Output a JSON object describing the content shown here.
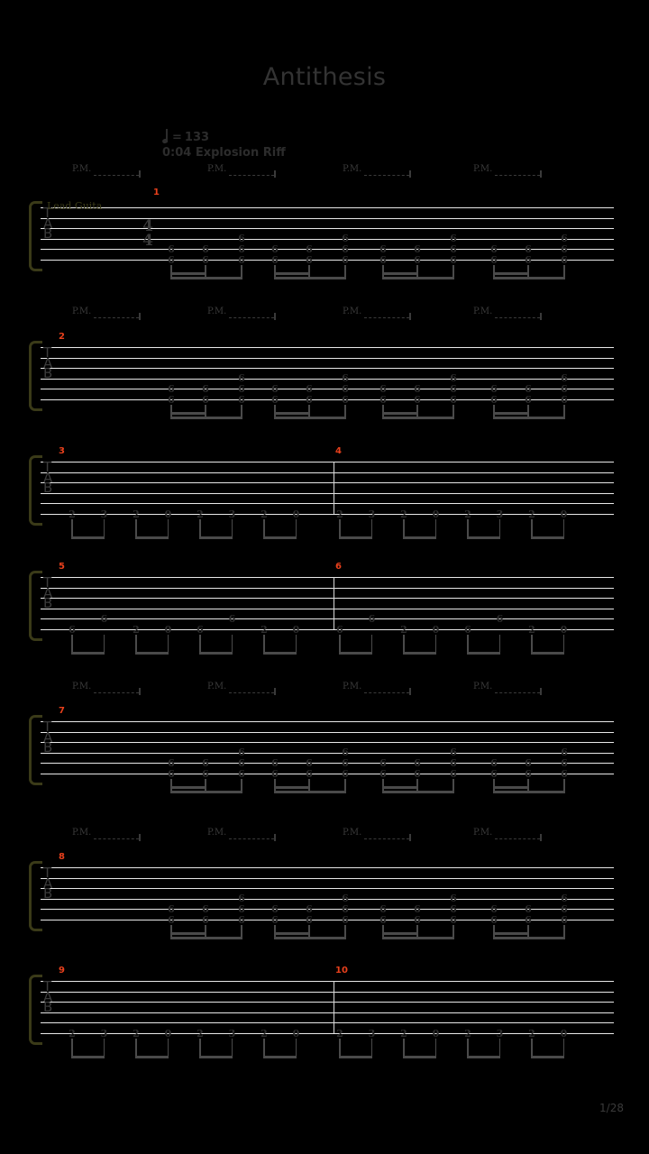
{
  "document": {
    "title": "Antithesis",
    "page_label": "1/28",
    "background_color": "#000000",
    "accent_color": "#e8401c",
    "staff_line_color": "#e8e8e8",
    "note_color": "#2e2e2e",
    "bracket_color": "#3a3a18"
  },
  "tempo": {
    "note_icon": "quarter-note-icon",
    "equals": "=",
    "bpm": "133"
  },
  "section": {
    "label": "0:04 Explosion Riff"
  },
  "instrument": {
    "name": "Lead Guita",
    "clef": "TAB",
    "time_signature": {
      "numerator": "4",
      "denominator": "4"
    }
  },
  "palm_mute": {
    "label": "P.M."
  },
  "systems": [
    {
      "id": "system-1",
      "measure_numbers": [
        "1"
      ],
      "pm_count": 4,
      "pattern": "power-chord-riff",
      "measures": [
        {
          "notes": [
            {
              "string": 6,
              "fret": "6"
            },
            {
              "string": 5,
              "fret": "6"
            },
            {
              "string": 6,
              "fret": "6"
            },
            {
              "string": 5,
              "fret": "6"
            },
            {
              "string": 6,
              "fret": "6"
            },
            {
              "string": 5,
              "fret": "6"
            },
            {
              "string": 4,
              "fret": "6"
            }
          ]
        }
      ]
    },
    {
      "id": "system-2",
      "measure_numbers": [
        "2"
      ],
      "pm_count": 4,
      "pattern": "power-chord-riff"
    },
    {
      "id": "system-3",
      "measure_numbers": [
        "3",
        "4"
      ],
      "pm_count": 0,
      "pattern": "single-note-run",
      "frets": [
        "2",
        "3",
        "2",
        "0",
        "2",
        "3",
        "2",
        "0",
        "2",
        "3",
        "2",
        "0",
        "2",
        "3",
        "2",
        "0"
      ]
    },
    {
      "id": "system-5",
      "measure_numbers": [
        "5",
        "6"
      ],
      "pm_count": 0,
      "pattern": "mixed-run",
      "frets": [
        "6",
        "6",
        "2",
        "0",
        "6",
        "6",
        "2",
        "0",
        "6",
        "6",
        "2",
        "0",
        "6",
        "6",
        "2",
        "0"
      ]
    },
    {
      "id": "system-7",
      "measure_numbers": [
        "7"
      ],
      "pm_count": 4,
      "pattern": "power-chord-riff"
    },
    {
      "id": "system-8",
      "measure_numbers": [
        "8"
      ],
      "pm_count": 4,
      "pattern": "power-chord-riff"
    },
    {
      "id": "system-9",
      "measure_numbers": [
        "9",
        "10"
      ],
      "pm_count": 0,
      "pattern": "single-note-run",
      "frets": [
        "2",
        "3",
        "2",
        "0",
        "2",
        "3",
        "2",
        "0",
        "2",
        "3",
        "2",
        "0",
        "2",
        "3",
        "2",
        "0"
      ]
    }
  ]
}
